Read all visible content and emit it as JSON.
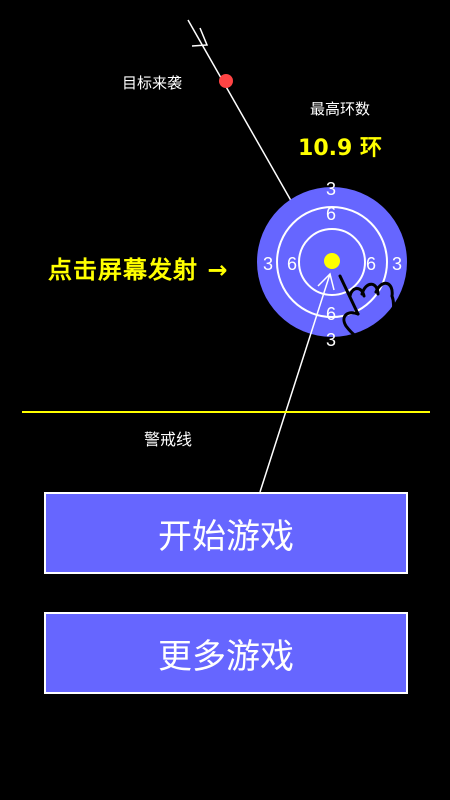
{
  "hud": {
    "incoming_target_label": "目标来袭",
    "best_label": "最高环数",
    "best_value": "10.9 环",
    "tap_hint": "点击屏幕发射 →",
    "warning_line_label": "警戒线"
  },
  "target": {
    "ring_values": [
      "3",
      "6",
      "3",
      "6",
      "6",
      "3",
      "6",
      "3"
    ]
  },
  "buttons": {
    "start_label": "开始游戏",
    "more_label": "更多游戏"
  },
  "colors": {
    "background": "#000000",
    "target_fill": "#6666ff",
    "highlight": "#ffff00",
    "incoming_dot": "#ff4444"
  }
}
